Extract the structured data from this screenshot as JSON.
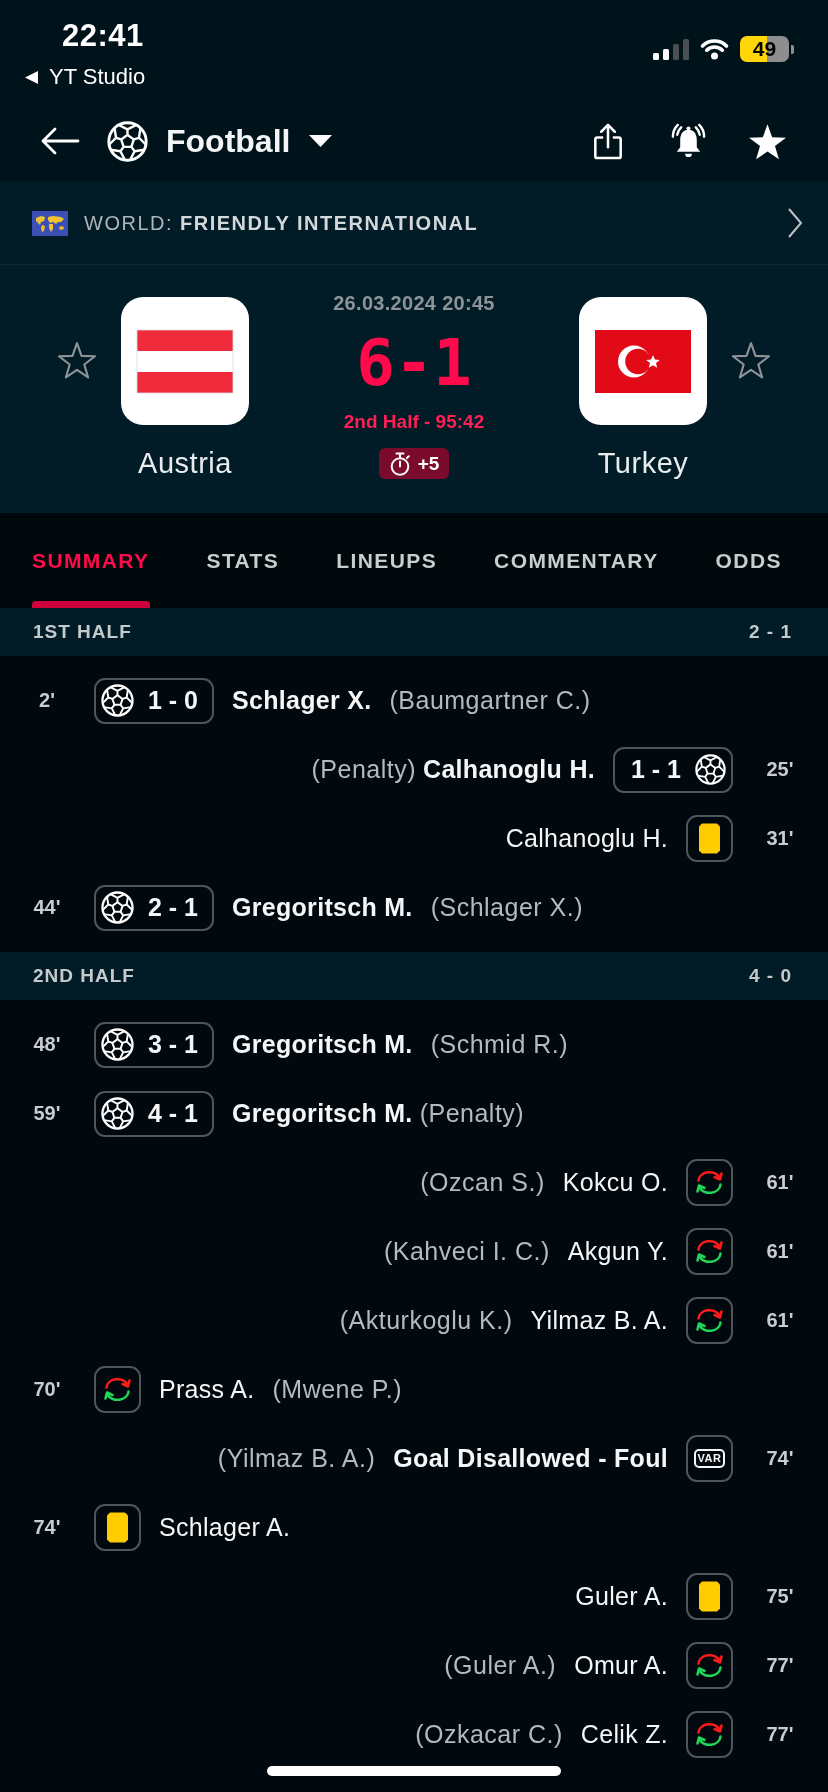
{
  "status_bar": {
    "time": "22:41",
    "back_app": "YT Studio",
    "battery": "49"
  },
  "nav": {
    "sport": "Football"
  },
  "competition": {
    "label": "WORLD: **FRIENDLY INTERNATIONAL**"
  },
  "match": {
    "date": "26.03.2024 20:45",
    "score": "6-1",
    "status": "2nd Half - 95:42",
    "added_time": "+5",
    "home": {
      "name": "Austria",
      "favorite": false
    },
    "away": {
      "name": "Turkey",
      "favorite": false
    }
  },
  "tabs": [
    {
      "label": "SUMMARY",
      "selected": true
    },
    {
      "label": "STATS",
      "selected": false
    },
    {
      "label": "LINEUPS",
      "selected": false
    },
    {
      "label": "COMMENTARY",
      "selected": false
    },
    {
      "label": "ODDS",
      "selected": false
    }
  ],
  "sections": [
    {
      "title": "1ST HALF",
      "score": "2 - 1",
      "events": [
        {
          "away": false,
          "kind": "goal",
          "minute": "2'",
          "score": "1 - 0",
          "main": "Schlager X.",
          "detail": "(Baumgartner C.)"
        },
        {
          "away": true,
          "kind": "goal",
          "minute": "25'",
          "score": "1 - 1",
          "main": "Calhanoglu H.",
          "note": "(Penalty)"
        },
        {
          "away": true,
          "kind": "card",
          "minute": "31'",
          "main": "Calhanoglu H."
        },
        {
          "away": false,
          "kind": "goal",
          "minute": "44'",
          "score": "2 - 1",
          "main": "Gregoritsch M.",
          "detail": "(Schlager X.)"
        }
      ]
    },
    {
      "title": "2ND HALF",
      "score": "4 - 0",
      "events": [
        {
          "away": false,
          "kind": "goal",
          "minute": "48'",
          "score": "3 - 1",
          "main": "Gregoritsch M.",
          "detail": "(Schmid R.)"
        },
        {
          "away": false,
          "kind": "goal",
          "minute": "59'",
          "score": "4 - 1",
          "main": "Gregoritsch M.",
          "note": "(Penalty)"
        },
        {
          "away": true,
          "kind": "substitution",
          "minute": "61'",
          "main": "Kokcu O.",
          "detail": "(Ozcan S.)"
        },
        {
          "away": true,
          "kind": "substitution",
          "minute": "61'",
          "main": "Akgun Y.",
          "detail": "(Kahveci I. C.)"
        },
        {
          "away": true,
          "kind": "substitution",
          "minute": "61'",
          "main": "Yilmaz B. A.",
          "detail": "(Akturkoglu K.)"
        },
        {
          "away": false,
          "kind": "substitution",
          "minute": "70'",
          "main": "Prass A.",
          "detail": "(Mwene P.)"
        },
        {
          "away": true,
          "kind": "var",
          "minute": "74'",
          "icon_text": "VAR",
          "main": "Goal Disallowed - Foul",
          "detail": "(Yilmaz B. A.)"
        },
        {
          "away": false,
          "kind": "card",
          "minute": "74'",
          "main": "Schlager A."
        },
        {
          "away": true,
          "kind": "card",
          "minute": "75'",
          "main": "Guler A."
        },
        {
          "away": true,
          "kind": "substitution",
          "minute": "77'",
          "main": "Omur A.",
          "detail": "(Guler A.)"
        },
        {
          "away": true,
          "kind": "substitution",
          "minute": "77'",
          "main": "Celik Z.",
          "detail": "(Ozkacar C.)"
        }
      ]
    }
  ]
}
